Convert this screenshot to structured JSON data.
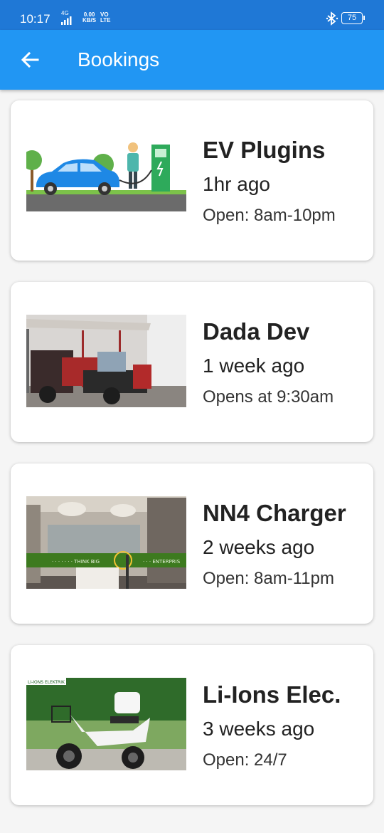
{
  "status_bar": {
    "time": "10:17",
    "network": "4G",
    "speed_value": "0.00",
    "speed_unit": "KB/S",
    "volte_top": "VO",
    "volte_bottom": "LTE",
    "battery": "75"
  },
  "app_bar": {
    "title": "Bookings",
    "back_icon": "arrow-left-icon"
  },
  "bookings": [
    {
      "name": "EV Plugins",
      "time_ago": "1hr ago",
      "hours": "Open: 8am-10pm"
    },
    {
      "name": "Dada Dev",
      "time_ago": "1 week ago",
      "hours": "Opens at 9:30am"
    },
    {
      "name": "NN4 Charger",
      "time_ago": "2 weeks ago",
      "hours": "Open: 8am-11pm"
    },
    {
      "name": "Li-Ions Elec.",
      "time_ago": "3 weeks ago",
      "hours": "Open: 24/7"
    }
  ],
  "image_signage": {
    "think_big": "· · · · · · · THINK BIG",
    "enterprise": "· · · ENTERPRIS",
    "li_ions_sign": "LI-IONS ELEKTRIK"
  },
  "colors": {
    "status_bar": "#1f78d6",
    "app_bar": "#2196f3",
    "card": "#ffffff",
    "background": "#f5f5f5"
  }
}
